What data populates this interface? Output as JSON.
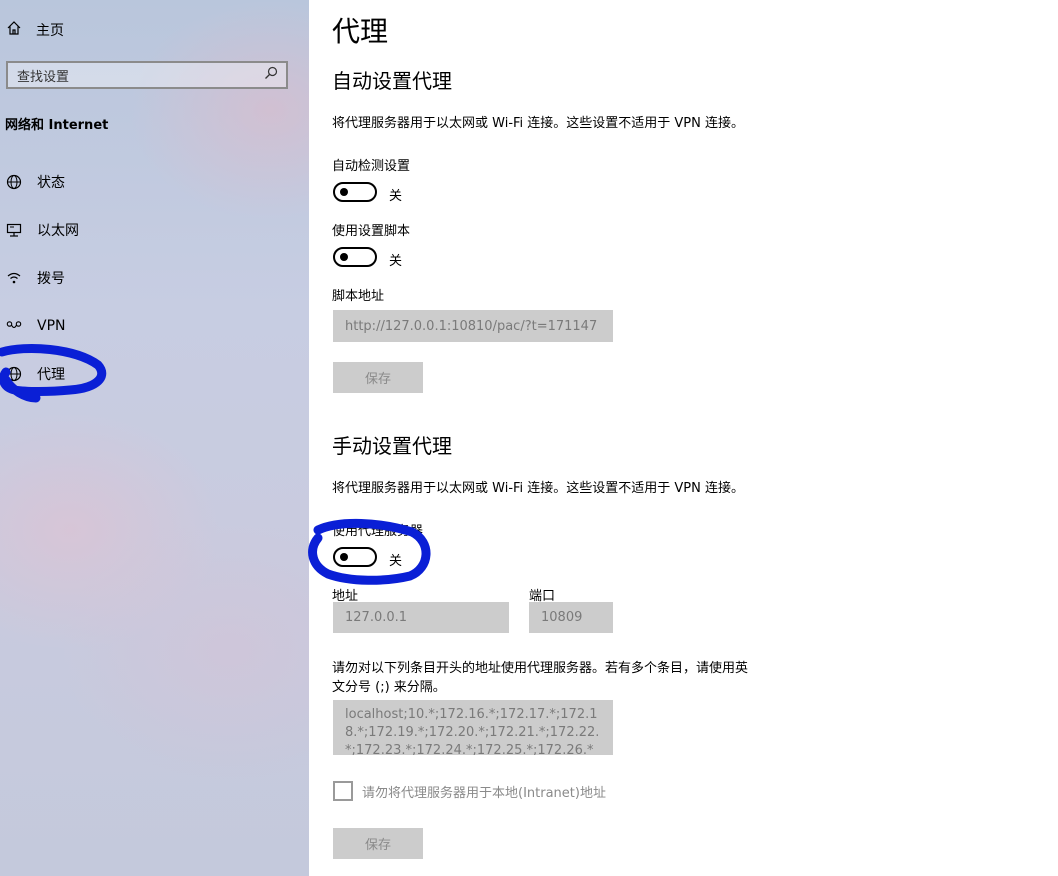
{
  "sidebar": {
    "home_label": "主页",
    "search_placeholder": "查找设置",
    "section_title": "网络和 Internet",
    "items": [
      {
        "label": "状态",
        "icon": "globe-status-icon"
      },
      {
        "label": "以太网",
        "icon": "ethernet-icon"
      },
      {
        "label": "拨号",
        "icon": "dialup-icon"
      },
      {
        "label": "VPN",
        "icon": "vpn-icon"
      },
      {
        "label": "代理",
        "icon": "globe-icon"
      }
    ]
  },
  "main": {
    "title": "代理",
    "auto": {
      "heading": "自动设置代理",
      "description": "将代理服务器用于以太网或 Wi-Fi 连接。这些设置不适用于 VPN 连接。",
      "auto_detect": {
        "label": "自动检测设置",
        "state": "关"
      },
      "use_script": {
        "label": "使用设置脚本",
        "state": "关"
      },
      "script_address": {
        "label": "脚本地址",
        "value": "http://127.0.0.1:10810/pac/?t=171147"
      },
      "save_label": "保存"
    },
    "manual": {
      "heading": "手动设置代理",
      "description": "将代理服务器用于以太网或 Wi-Fi 连接。这些设置不适用于 VPN 连接。",
      "use_proxy": {
        "label": "使用代理服务器",
        "state": "关"
      },
      "address": {
        "label": "地址",
        "value": "127.0.0.1"
      },
      "port": {
        "label": "端口",
        "value": "10809"
      },
      "exceptions_label_line1": "请勿对以下列条目开头的地址使用代理服务器。若有多个条目，请使用英",
      "exceptions_label_line2": "文分号 (;) 来分隔。",
      "exceptions_value": "localhost;10.*;172.16.*;172.17.*;172.18.*;172.19.*;172.20.*;172.21.*;172.22.*;172.23.*;172.24.*;172.25.*;172.26.*",
      "local_bypass_label": "请勿将代理服务器用于本地(Intranet)地址",
      "save_label": "保存"
    }
  },
  "annotation_color": "#0a1fd6"
}
